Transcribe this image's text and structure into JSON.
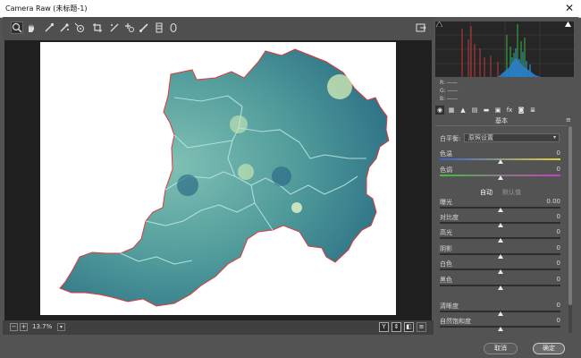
{
  "window": {
    "title": "Camera Raw (未标题-1)",
    "close_glyph": "✕"
  },
  "toolbar": {
    "tools": [
      {
        "name": "zoom-tool-icon",
        "glyph": "⌕"
      },
      {
        "name": "hand-tool-icon",
        "glyph": "✋"
      },
      {
        "name": "white-balance-tool-icon",
        "glyph": "⚲"
      },
      {
        "name": "color-sampler-tool-icon",
        "glyph": "⚲"
      },
      {
        "name": "targeted-adjustment-tool-icon",
        "glyph": "◎"
      },
      {
        "name": "crop-tool-icon",
        "glyph": "⌗"
      },
      {
        "name": "straighten-tool-icon",
        "glyph": "⟋"
      },
      {
        "name": "spot-removal-tool-icon",
        "glyph": "✚"
      },
      {
        "name": "adjustment-brush-icon",
        "glyph": "✎"
      },
      {
        "name": "graduated-filter-icon",
        "glyph": "▥"
      },
      {
        "name": "radial-filter-icon",
        "glyph": "◯"
      },
      {
        "name": "open-preferences-icon",
        "glyph": "⇥"
      }
    ]
  },
  "status": {
    "zoom_value": "13.7%",
    "view_buttons": [
      "Y",
      "⇕",
      "◧",
      "≡"
    ]
  },
  "histogram": {
    "rgb_readout": [
      "R:  ——",
      "G:  ——",
      "B:  ——"
    ]
  },
  "panel": {
    "section_title": "基本",
    "white_balance_label": "白平衡:",
    "white_balance_value": "原照设置",
    "auto_label": "自动",
    "default_label": "默认值",
    "sliders": [
      {
        "key": "temperature",
        "label": "色温",
        "value": "0",
        "thumb": 0.5
      },
      {
        "key": "tint",
        "label": "色调",
        "value": "0",
        "thumb": 0.5
      },
      {
        "key": "exposure",
        "label": "曝光",
        "value": "0.00",
        "thumb": 0.5
      },
      {
        "key": "contrast",
        "label": "对比度",
        "value": "0",
        "thumb": 0.5
      },
      {
        "key": "highlights",
        "label": "高光",
        "value": "0",
        "thumb": 0.5
      },
      {
        "key": "shadows",
        "label": "阴影",
        "value": "0",
        "thumb": 0.5
      },
      {
        "key": "whites",
        "label": "白色",
        "value": "0",
        "thumb": 0.5
      },
      {
        "key": "blacks",
        "label": "黑色",
        "value": "0",
        "thumb": 0.5
      },
      {
        "key": "clarity",
        "label": "清晰度",
        "value": "0",
        "thumb": 0.5
      },
      {
        "key": "vibrance",
        "label": "自然饱和度",
        "value": "0",
        "thumb": 0.5
      }
    ]
  },
  "buttons": {
    "cancel": "取消",
    "ok": "确定"
  },
  "colors": {
    "map_fill": "#4f9a9a",
    "map_edge": "#e03a3a",
    "map_inner": "#b7e5e1"
  }
}
